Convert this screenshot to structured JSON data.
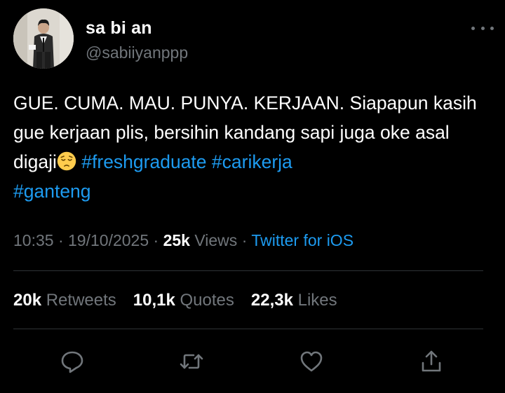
{
  "author": {
    "display_name": "sa bi an",
    "handle": "@sabiiyanppp"
  },
  "tweet": {
    "text_before_emoji": "GUE. CUMA. MAU. PUNYA. KERJAAN. Siapapun kasih gue kerjaan plis, bersihin kandang sapi juga oke asal digaji",
    "emoji": "pensive-face",
    "hashtags": [
      "#freshgraduate",
      "#carikerja",
      "#ganteng"
    ]
  },
  "meta": {
    "time": "10:35",
    "sep1": "·",
    "date": "19/10/2025",
    "sep2": "·",
    "views_count": "25k",
    "views_label": "Views",
    "sep3": "·",
    "source": "Twitter for iOS"
  },
  "stats": {
    "retweets_count": "20k",
    "retweets_label": "Retweets",
    "quotes_count": "10,1k",
    "quotes_label": "Quotes",
    "likes_count": "22,3k",
    "likes_label": "Likes"
  },
  "actions": [
    "reply-icon",
    "retweet-icon",
    "like-icon",
    "share-icon"
  ],
  "colors": {
    "background": "#000000",
    "text": "#ffffff",
    "secondary": "#71767b",
    "link": "#1d9bf0",
    "divider": "#2f3336"
  }
}
